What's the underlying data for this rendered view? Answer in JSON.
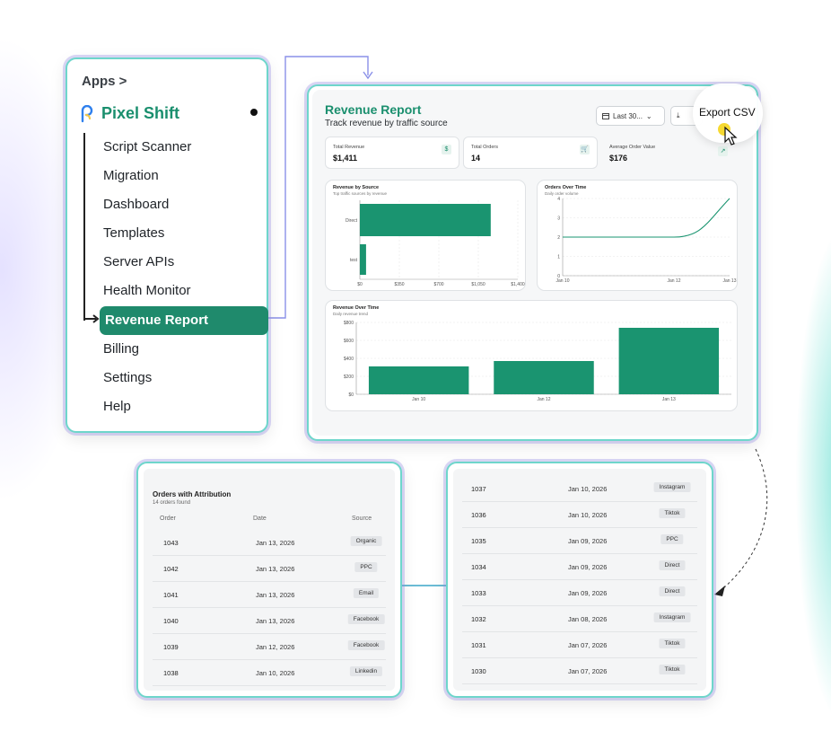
{
  "nav": {
    "breadcrumb": "Apps >",
    "brand": "Pixel Shift",
    "items": [
      "Script Scanner",
      "Migration",
      "Dashboard",
      "Templates",
      "Server APIs",
      "Health Monitor",
      "Revenue Report",
      "Billing",
      "Settings",
      "Help"
    ],
    "active_index": 6
  },
  "report": {
    "title": "Revenue Report",
    "subtitle": "Track revenue by traffic source",
    "date_range": "Last 30...",
    "export_label": "Export CSV",
    "kpis": [
      {
        "label": "Total Revenue",
        "value": "$1,411",
        "icon": "dollar-icon"
      },
      {
        "label": "Total Orders",
        "value": "14",
        "icon": "cart-icon"
      },
      {
        "label": "Average Order Value",
        "value": "$176",
        "icon": "trend-icon"
      }
    ]
  },
  "colors": {
    "accent": "#1a8f6e",
    "bar": "#1a9470",
    "outline": "#6ed6cb"
  },
  "chart_data": [
    {
      "type": "bar",
      "orientation": "horizontal",
      "title": "Revenue by Source",
      "subtitle": "Top traffic sources by revenue",
      "categories": [
        "Direct",
        "test"
      ],
      "values": [
        1160,
        55
      ],
      "xlim": [
        0,
        1400
      ],
      "x_ticks": [
        "$0",
        "$350",
        "$700",
        "$1,050",
        "$1,400"
      ],
      "grid": true
    },
    {
      "type": "line",
      "title": "Orders Over Time",
      "subtitle": "Daily order volume",
      "x": [
        "Jan 10",
        "Jan 11",
        "Jan 12",
        "Jan 13"
      ],
      "values": [
        2,
        2,
        2,
        4
      ],
      "x_ticks": [
        "Jan 10",
        "Jan 12",
        "Jan 13"
      ],
      "ylim": [
        0,
        4
      ],
      "y_ticks": [
        "0",
        "1",
        "2",
        "3",
        "4"
      ],
      "grid": true
    },
    {
      "type": "bar",
      "title": "Revenue Over Time",
      "subtitle": "Daily revenue trend",
      "categories": [
        "Jan 10",
        "Jan 12",
        "Jan 13"
      ],
      "values": [
        310,
        370,
        740
      ],
      "ylim": [
        0,
        800
      ],
      "y_ticks": [
        "$0",
        "$200",
        "$400",
        "$600",
        "$800"
      ],
      "grid": true
    }
  ],
  "orders": {
    "title": "Orders with Attribution",
    "count_text": "14 orders found",
    "headers": [
      "Order",
      "Date",
      "Source"
    ],
    "page1": [
      [
        "1043",
        "Jan 13, 2026",
        "Organic"
      ],
      [
        "1042",
        "Jan 13, 2026",
        "PPC"
      ],
      [
        "1041",
        "Jan 13, 2026",
        "Email"
      ],
      [
        "1040",
        "Jan 13, 2026",
        "Facebook"
      ],
      [
        "1039",
        "Jan 12, 2026",
        "Facebook"
      ],
      [
        "1038",
        "Jan 10, 2026",
        "Linkedin"
      ]
    ],
    "page2": [
      [
        "1037",
        "Jan 10, 2026",
        "Instagram"
      ],
      [
        "1036",
        "Jan 10, 2026",
        "Tiktok"
      ],
      [
        "1035",
        "Jan 09, 2026",
        "PPC"
      ],
      [
        "1034",
        "Jan 09, 2026",
        "Direct"
      ],
      [
        "1033",
        "Jan 09, 2026",
        "Direct"
      ],
      [
        "1032",
        "Jan 08, 2026",
        "Instagram"
      ],
      [
        "1031",
        "Jan 07, 2026",
        "Tiktok"
      ],
      [
        "1030",
        "Jan 07, 2026",
        "Tiktok"
      ]
    ]
  }
}
